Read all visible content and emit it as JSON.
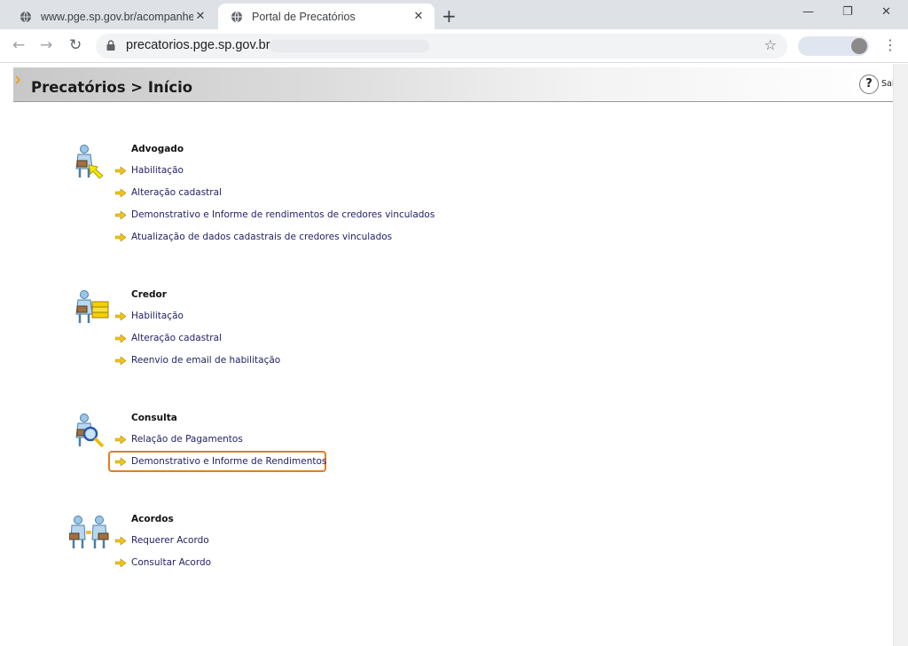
{
  "browser": {
    "tabs": [
      {
        "title": "www.pge.sp.gov.br/acompanhe/p",
        "close": "✕"
      },
      {
        "title": "Portal de Precatórios",
        "close": "✕"
      }
    ],
    "new_tab": "+",
    "window_controls": {
      "minimize": "—",
      "restore": "❐",
      "close": "✕"
    },
    "nav": {
      "back": "←",
      "forward": "→",
      "reload": "↻"
    },
    "url": "precatorios.pge.sp.gov.br",
    "bookmark": "☆",
    "menu": "⋮"
  },
  "header": {
    "title": "Precatórios > Início",
    "help": "?",
    "logout": "Sair"
  },
  "sections": [
    {
      "title": "Advogado",
      "icon": "advogado-icon",
      "links": [
        "Habilitação",
        "Alteração cadastral",
        "Demonstrativo e Informe de rendimentos de credores vinculados",
        "Atualização de dados cadastrais de credores vinculados"
      ]
    },
    {
      "title": "Credor",
      "icon": "credor-icon",
      "links": [
        "Habilitação",
        "Alteração cadastral",
        "Reenvio de email de habilitação"
      ]
    },
    {
      "title": "Consulta",
      "icon": "consulta-icon",
      "links": [
        "Relação de Pagamentos",
        "Demonstrativo e Informe de Rendimentos"
      ]
    },
    {
      "title": "Acordos",
      "icon": "acordos-icon",
      "links": [
        "Requerer Acordo",
        "Consultar Acordo"
      ]
    }
  ],
  "colors": {
    "highlight": "#e27e20",
    "link": "#222266",
    "arrow": "#f0c419"
  }
}
